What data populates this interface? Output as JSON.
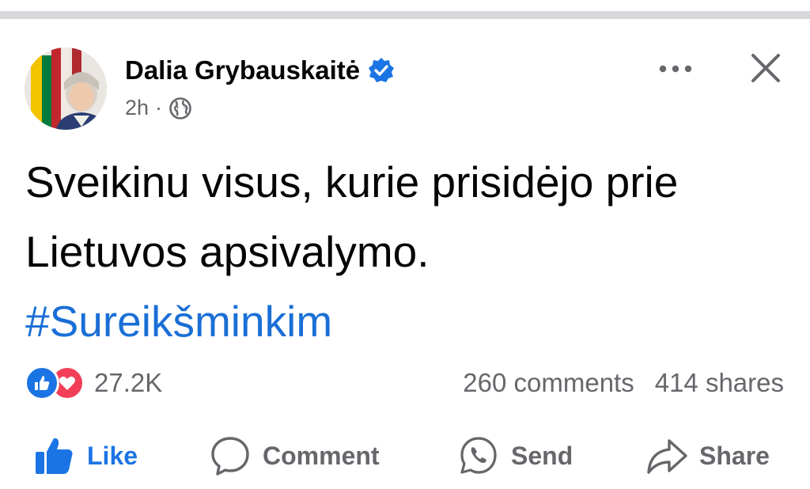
{
  "post": {
    "author": {
      "name": "Dalia Grybauskaitė",
      "verified": true,
      "verified_icon": "verified-badge-icon"
    },
    "time": "2h",
    "separator": "·",
    "audience_icon": "globe-icon",
    "text": "Sveikinu visus, kurie prisidėjo prie Lietuvos apsivalymo.",
    "hashtag": "#Sureikšminkim"
  },
  "header_actions": {
    "more_icon": "more-horizontal-icon",
    "close_icon": "close-icon"
  },
  "engagement": {
    "reaction_icons": [
      "like-reaction-icon",
      "love-reaction-icon"
    ],
    "reaction_count": "27.2K",
    "comments": "260 comments",
    "shares": "414 shares"
  },
  "actions": {
    "like": "Like",
    "comment": "Comment",
    "send": "Send",
    "share": "Share"
  },
  "colors": {
    "accent": "#1b74e4",
    "hashtag": "#1a6fd6",
    "love": "#f33e58",
    "text": "#050505",
    "secondary": "#65676b",
    "divider": "#d7d8db"
  }
}
